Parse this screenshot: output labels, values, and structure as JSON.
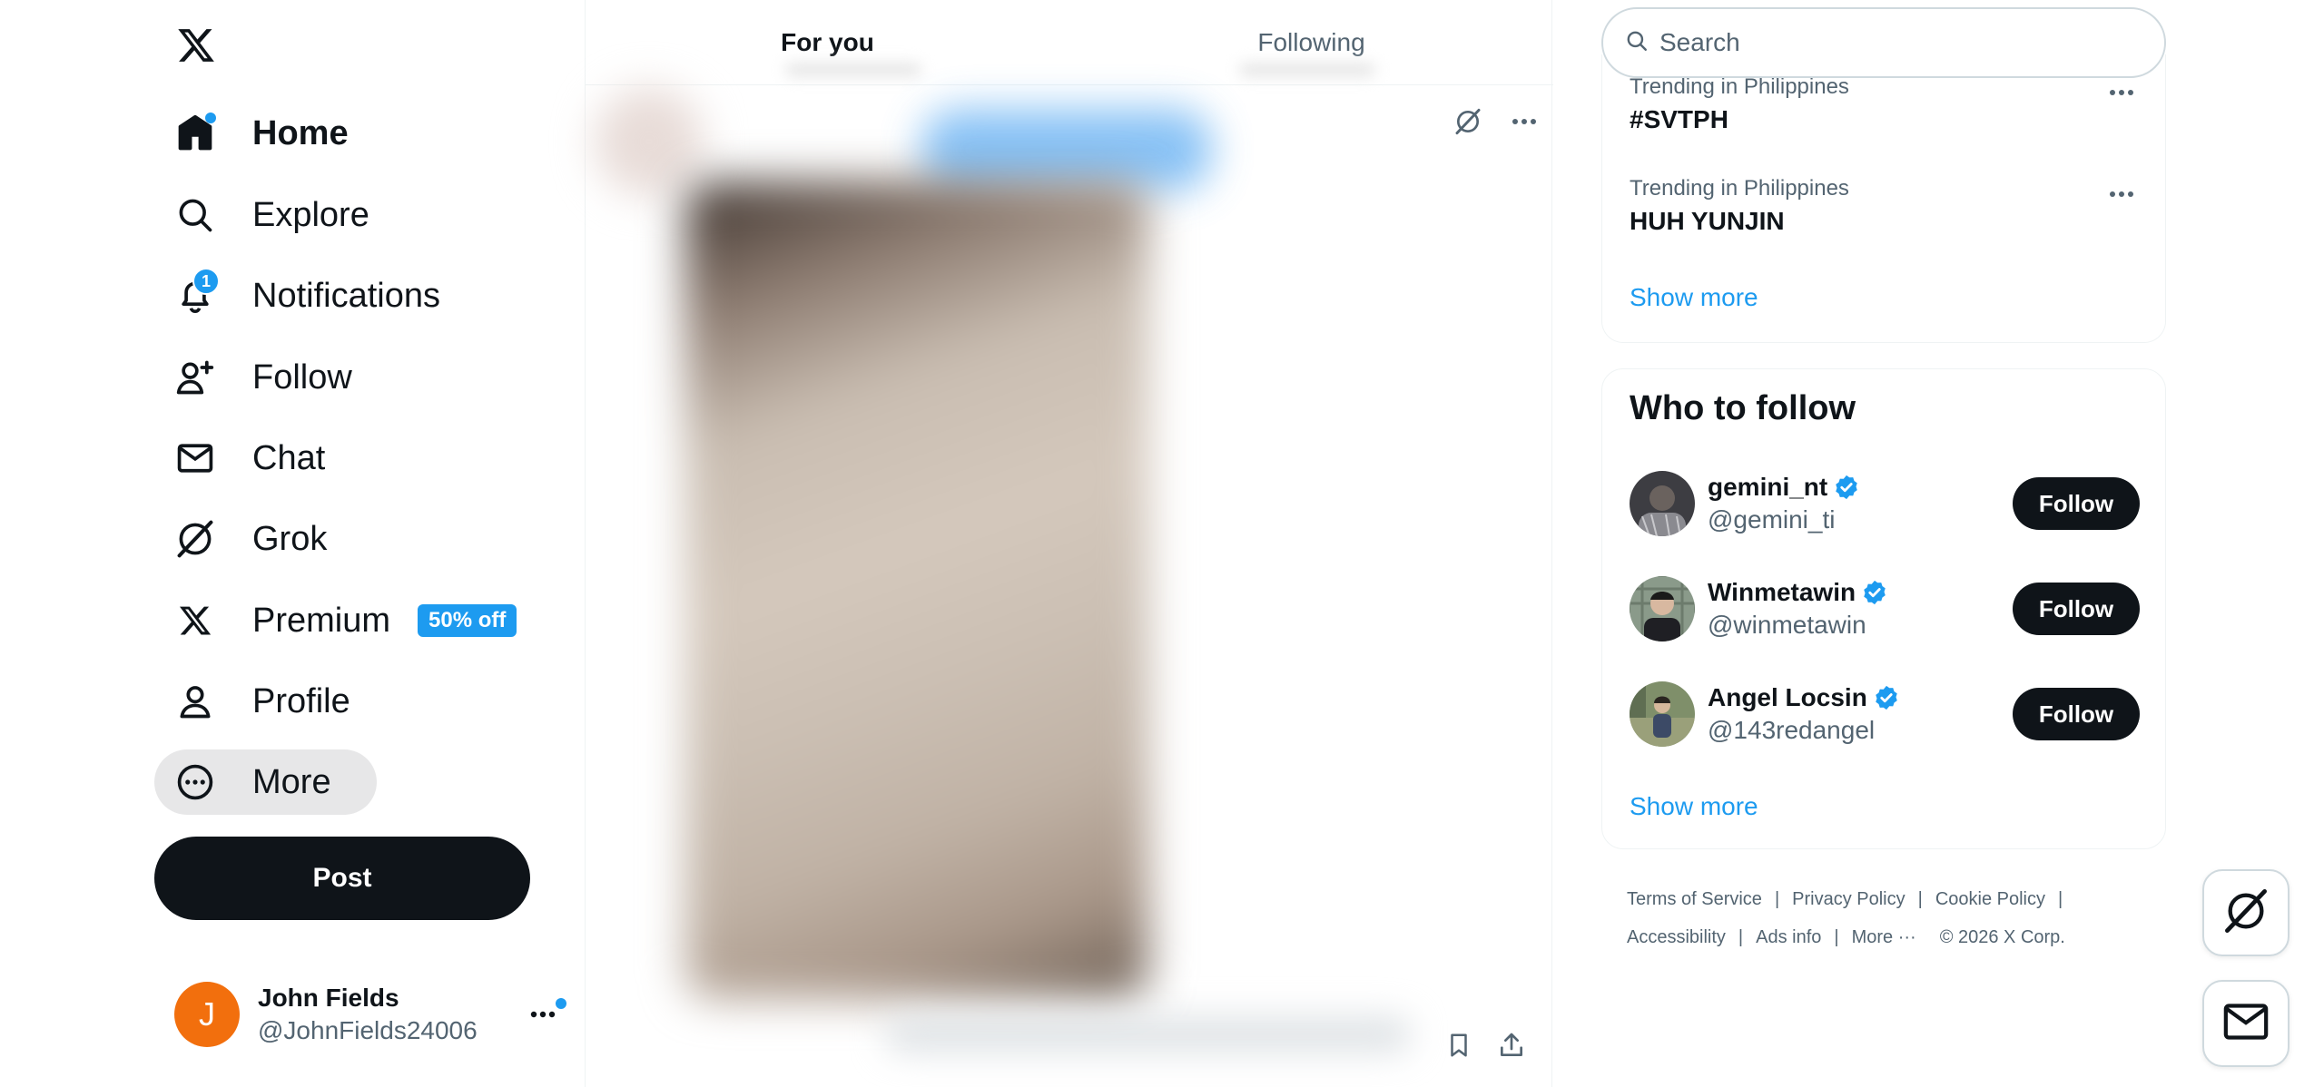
{
  "nav": {
    "items": [
      {
        "id": "home",
        "label": "Home",
        "icon": "home-icon"
      },
      {
        "id": "explore",
        "label": "Explore",
        "icon": "search-icon"
      },
      {
        "id": "notifications",
        "label": "Notifications",
        "icon": "bell-icon",
        "badge": "1"
      },
      {
        "id": "follow",
        "label": "Follow",
        "icon": "person-plus-icon"
      },
      {
        "id": "chat",
        "label": "Chat",
        "icon": "mail-icon"
      },
      {
        "id": "grok",
        "label": "Grok",
        "icon": "grok-icon"
      },
      {
        "id": "premium",
        "label": "Premium",
        "icon": "x-logo-icon",
        "promo": "50% off"
      },
      {
        "id": "profile",
        "label": "Profile",
        "icon": "person-icon"
      },
      {
        "id": "more",
        "label": "More",
        "icon": "more-circle-icon"
      }
    ],
    "post_label": "Post"
  },
  "account": {
    "initial": "J",
    "name": "John Fields",
    "handle": "@JohnFields24006"
  },
  "timeline": {
    "tabs": [
      {
        "label": "For you",
        "active": true
      },
      {
        "label": "Following",
        "active": false
      }
    ]
  },
  "search": {
    "placeholder": "Search"
  },
  "trends": {
    "items": [
      {
        "meta": "Trending in Philippines",
        "name": "#SVTPH"
      },
      {
        "meta": "Trending in Philippines",
        "name": "HUH YUNJIN"
      }
    ],
    "show_more": "Show more"
  },
  "who_to_follow": {
    "title": "Who to follow",
    "users": [
      {
        "name": "gemini_nt",
        "handle": "@gemini_ti",
        "button": "Follow"
      },
      {
        "name": "Winmetawin",
        "handle": "@winmetawin",
        "button": "Follow"
      },
      {
        "name": "Angel Locsin",
        "handle": "@143redangel",
        "button": "Follow"
      }
    ],
    "show_more": "Show more"
  },
  "footer": {
    "terms": "Terms of Service",
    "privacy": "Privacy Policy",
    "cookie": "Cookie Policy",
    "accessibility": "Accessibility",
    "ads": "Ads info",
    "more": "More ···",
    "copyright": "© 2026 X Corp."
  },
  "colors": {
    "accent": "#1d9bf0",
    "text": "#0f1419",
    "secondary": "#536471",
    "avatar": "#f26f0d"
  }
}
